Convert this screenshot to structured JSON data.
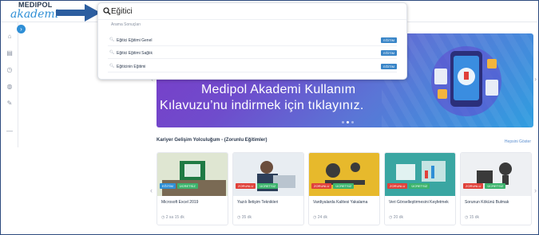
{
  "brand": {
    "line1": "MEDIPOL",
    "line2": "akademi"
  },
  "sidebar": {
    "toggle": "›",
    "items": [
      {
        "icon": "home-icon",
        "glyph": "⌂"
      },
      {
        "icon": "book-icon",
        "glyph": "▤"
      },
      {
        "icon": "clock-icon",
        "glyph": "◷"
      },
      {
        "icon": "globe-icon",
        "glyph": "◍"
      },
      {
        "icon": "edit-icon",
        "glyph": "✎"
      },
      {
        "icon": "more-icon",
        "glyph": "—"
      }
    ]
  },
  "search": {
    "value": "Eğitici",
    "suggestions_title": "Arama Sonuçları",
    "results": [
      {
        "label": "Eğitici Eğitimi Genel",
        "badge": "EĞİTİM"
      },
      {
        "label": "Eğitici Eğitimi Sağlık",
        "badge": "EĞİTİM"
      },
      {
        "label": "Eğiticinin Eğitimi",
        "badge": "EĞİTİM"
      }
    ]
  },
  "banner": {
    "line1": "Medipol Akademi Kullanım",
    "line2": "Kılavuzu’nu indirmek için tıklayınız.",
    "slides": 3,
    "active_slide": 2
  },
  "section": {
    "title": "Kariyer Gelişim Yolculuğum - (Zorunlu Eğitimler)",
    "see_all": "Hepsini Göster"
  },
  "cards": [
    {
      "title": "Microsoft Excel 2019",
      "duration": "2 sa 15 dk",
      "tags": [
        {
          "text": "EĞİTİM",
          "color": "blue"
        },
        {
          "text": "ÜCRETSİZ",
          "color": "green"
        }
      ]
    },
    {
      "title": "Yazılı İletişim Teknikleri",
      "duration": "35 dk",
      "tags": [
        {
          "text": "ZORUNLU",
          "color": "red"
        },
        {
          "text": "ÜCRETSİZ",
          "color": "green"
        }
      ]
    },
    {
      "title": "Vardiyalarda Kalitesi Yakalama",
      "duration": "24 dk",
      "tags": [
        {
          "text": "ZORUNLU",
          "color": "red"
        },
        {
          "text": "ÜCRETSİZ",
          "color": "green"
        }
      ]
    },
    {
      "title": "Veri Görselleştirmesini Keşfetmek",
      "duration": "20 dk",
      "tags": [
        {
          "text": "ZORUNLU",
          "color": "red"
        },
        {
          "text": "ÜCRETSİZ",
          "color": "green"
        }
      ]
    },
    {
      "title": "Sorunun Kökünü Bulmak",
      "duration": "15 dk",
      "tags": [
        {
          "text": "ZORUNLU",
          "color": "red"
        },
        {
          "text": "ÜCRETSİZ",
          "color": "green"
        }
      ]
    }
  ],
  "colors": {
    "accent": "#2f8fd6",
    "frame": "#2c4a7e",
    "required": "#e0413a",
    "free": "#3bb36c"
  }
}
